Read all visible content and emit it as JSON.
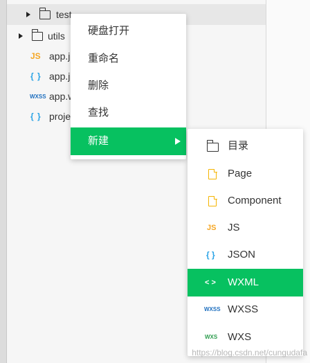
{
  "tree": {
    "items": [
      {
        "label": "test",
        "kind": "folder",
        "expanded": false
      },
      {
        "label": "utils",
        "kind": "folder",
        "expanded": false
      },
      {
        "label": "app.j",
        "kind": "js"
      },
      {
        "label": "app.j",
        "kind": "json"
      },
      {
        "label": "app.w",
        "kind": "wxss"
      },
      {
        "label": "proje",
        "kind": "json"
      }
    ],
    "icons": {
      "js": "JS",
      "json": "{ }",
      "wxss": "WXSS"
    }
  },
  "context_menu": {
    "items": [
      {
        "label": "硬盘打开"
      },
      {
        "label": "重命名"
      },
      {
        "label": "删除"
      },
      {
        "label": "查找"
      },
      {
        "label": "新建",
        "active": true,
        "has_submenu": true
      }
    ]
  },
  "submenu": {
    "items": [
      {
        "label": "目录",
        "icon": "folder-icon"
      },
      {
        "label": "Page",
        "icon": "page-file-icon"
      },
      {
        "label": "Component",
        "icon": "component-file-icon"
      },
      {
        "label": "JS",
        "icon": "js-icon",
        "icon_text": "JS"
      },
      {
        "label": "JSON",
        "icon": "json-icon",
        "icon_text": "{ }"
      },
      {
        "label": "WXML",
        "icon": "wxml-icon",
        "icon_text": "< >",
        "active": true
      },
      {
        "label": "WXSS",
        "icon": "wxss-icon",
        "icon_text": "WXSS"
      },
      {
        "label": "WXS",
        "icon": "wxs-icon",
        "icon_text": "WXS"
      }
    ]
  },
  "colors": {
    "accent": "#07c160",
    "js": "#f5a623",
    "json": "#29a3e6",
    "wxss": "#1e6fbf",
    "wxs": "#2e9d4f"
  },
  "watermark": "https://blog.csdn.net/cungudafa"
}
